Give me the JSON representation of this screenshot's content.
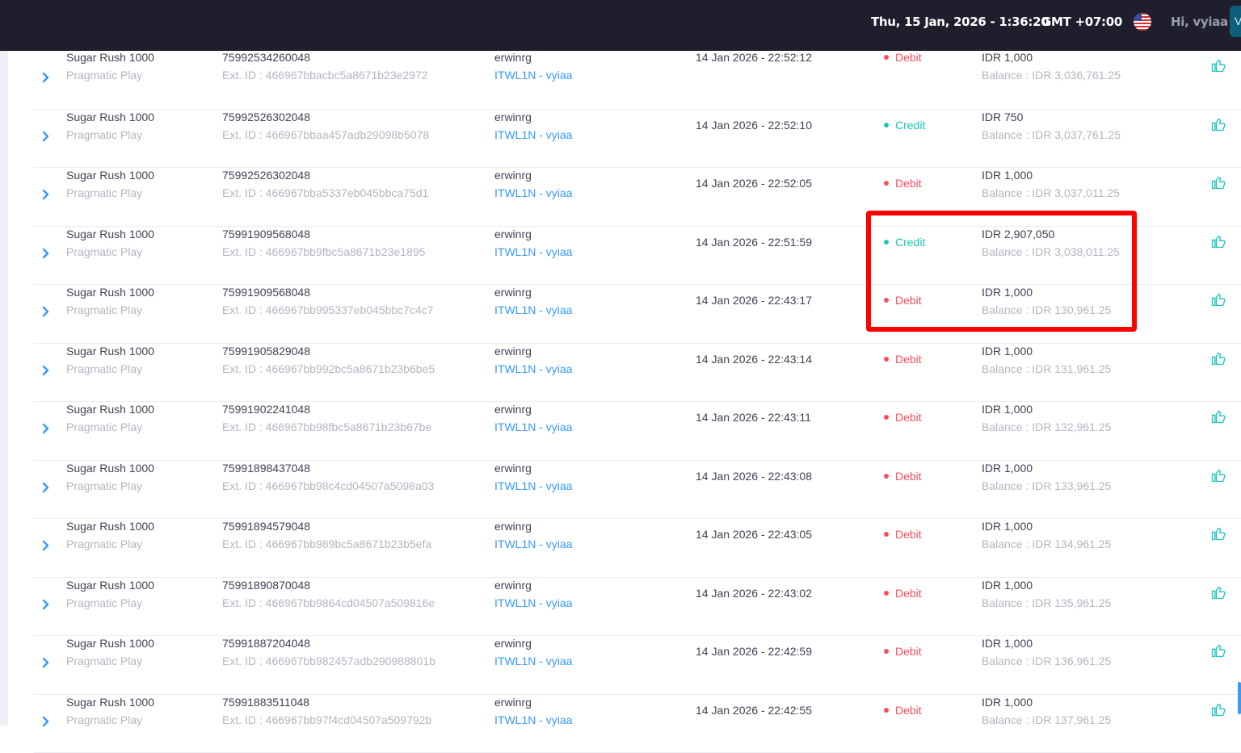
{
  "topbar": {
    "datetime": "Thu, 15 Jan, 2026 - 1:36:20",
    "timezone": "GMT +07:00",
    "greeting": "Hi, vyiaa",
    "avatar_letter": "V",
    "flag_icon": "us-flag-icon"
  },
  "colors": {
    "topbar_bg": "#1e1e2d",
    "debit": "#f64e60",
    "credit": "#1bc5bd",
    "link": "#3699ff",
    "highlight": "#ff0000"
  },
  "transactions": [
    {
      "game": "Sugar Rush 1000",
      "provider": "Pragmatic Play",
      "id": "75992534260048",
      "ext": "Ext. ID : 466967bbacbc5a8671b23e2972",
      "user": "erwinrg",
      "agent": "ITWL1N - vyiaa",
      "date": "14 Jan 2026 - 22:52:12",
      "type": "Debit",
      "amount": "IDR 1,000",
      "balance": "Balance : IDR 3,036,761.25"
    },
    {
      "game": "Sugar Rush 1000",
      "provider": "Pragmatic Play",
      "id": "75992526302048",
      "ext": "Ext. ID : 466967bbaa457adb29098b5078",
      "user": "erwinrg",
      "agent": "ITWL1N - vyiaa",
      "date": "14 Jan 2026 - 22:52:10",
      "type": "Credit",
      "amount": "IDR 750",
      "balance": "Balance : IDR 3,037,761.25"
    },
    {
      "game": "Sugar Rush 1000",
      "provider": "Pragmatic Play",
      "id": "75992526302048",
      "ext": "Ext. ID : 466967bba5337eb045bbca75d1",
      "user": "erwinrg",
      "agent": "ITWL1N - vyiaa",
      "date": "14 Jan 2026 - 22:52:05",
      "type": "Debit",
      "amount": "IDR 1,000",
      "balance": "Balance : IDR 3,037,011.25"
    },
    {
      "game": "Sugar Rush 1000",
      "provider": "Pragmatic Play",
      "id": "75991909568048",
      "ext": "Ext. ID : 466967bb9fbc5a8671b23e1895",
      "user": "erwinrg",
      "agent": "ITWL1N - vyiaa",
      "date": "14 Jan 2026 - 22:51:59",
      "type": "Credit",
      "amount": "IDR 2,907,050",
      "balance": "Balance : IDR 3,038,011.25"
    },
    {
      "game": "Sugar Rush 1000",
      "provider": "Pragmatic Play",
      "id": "75991909568048",
      "ext": "Ext. ID : 466967bb995337eb045bbc7c4c7",
      "user": "erwinrg",
      "agent": "ITWL1N - vyiaa",
      "date": "14 Jan 2026 - 22:43:17",
      "type": "Debit",
      "amount": "IDR 1,000",
      "balance": "Balance : IDR 130,961.25"
    },
    {
      "game": "Sugar Rush 1000",
      "provider": "Pragmatic Play",
      "id": "75991905829048",
      "ext": "Ext. ID : 466967bb992bc5a8671b23b6be5",
      "user": "erwinrg",
      "agent": "ITWL1N - vyiaa",
      "date": "14 Jan 2026 - 22:43:14",
      "type": "Debit",
      "amount": "IDR 1,000",
      "balance": "Balance : IDR 131,961.25"
    },
    {
      "game": "Sugar Rush 1000",
      "provider": "Pragmatic Play",
      "id": "75991902241048",
      "ext": "Ext. ID : 466967bb98fbc5a8671b23b67be",
      "user": "erwinrg",
      "agent": "ITWL1N - vyiaa",
      "date": "14 Jan 2026 - 22:43:11",
      "type": "Debit",
      "amount": "IDR 1,000",
      "balance": "Balance : IDR 132,961.25"
    },
    {
      "game": "Sugar Rush 1000",
      "provider": "Pragmatic Play",
      "id": "75991898437048",
      "ext": "Ext. ID : 466967bb98c4cd04507a5098a03",
      "user": "erwinrg",
      "agent": "ITWL1N - vyiaa",
      "date": "14 Jan 2026 - 22:43:08",
      "type": "Debit",
      "amount": "IDR 1,000",
      "balance": "Balance : IDR 133,961.25"
    },
    {
      "game": "Sugar Rush 1000",
      "provider": "Pragmatic Play",
      "id": "75991894579048",
      "ext": "Ext. ID : 466967bb989bc5a8671b23b5efa",
      "user": "erwinrg",
      "agent": "ITWL1N - vyiaa",
      "date": "14 Jan 2026 - 22:43:05",
      "type": "Debit",
      "amount": "IDR 1,000",
      "balance": "Balance : IDR 134,961.25"
    },
    {
      "game": "Sugar Rush 1000",
      "provider": "Pragmatic Play",
      "id": "75991890870048",
      "ext": "Ext. ID : 466967bb9864cd04507a509816e",
      "user": "erwinrg",
      "agent": "ITWL1N - vyiaa",
      "date": "14 Jan 2026 - 22:43:02",
      "type": "Debit",
      "amount": "IDR 1,000",
      "balance": "Balance : IDR 135,961.25"
    },
    {
      "game": "Sugar Rush 1000",
      "provider": "Pragmatic Play",
      "id": "75991887204048",
      "ext": "Ext. ID : 466967bb982457adb290988801b",
      "user": "erwinrg",
      "agent": "ITWL1N - vyiaa",
      "date": "14 Jan 2026 - 22:42:59",
      "type": "Debit",
      "amount": "IDR 1,000",
      "balance": "Balance : IDR 136,961.25"
    },
    {
      "game": "Sugar Rush 1000",
      "provider": "Pragmatic Play",
      "id": "75991883511048",
      "ext": "Ext. ID : 466967bb97f4cd04507a509792b",
      "user": "erwinrg",
      "agent": "ITWL1N - vyiaa",
      "date": "14 Jan 2026 - 22:42:55",
      "type": "Debit",
      "amount": "IDR 1,000",
      "balance": "Balance : IDR 137,961.25"
    }
  ]
}
